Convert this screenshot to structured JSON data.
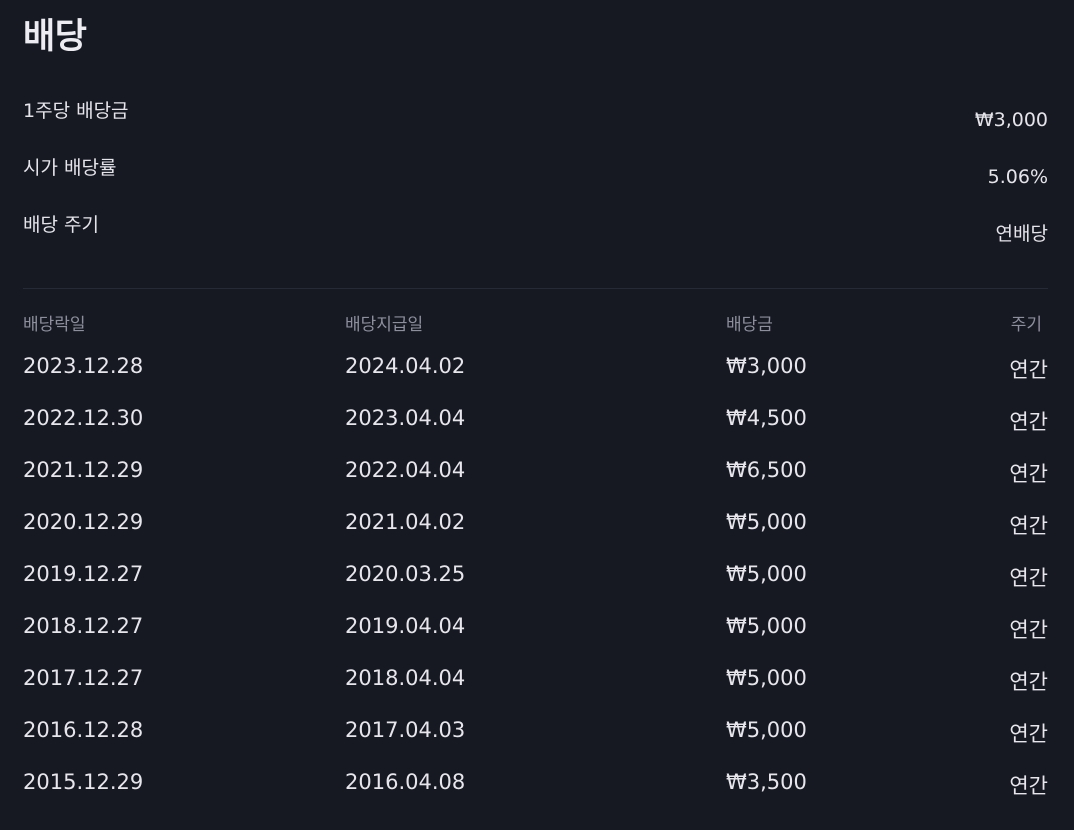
{
  "page": {
    "title": "배당"
  },
  "summary": [
    {
      "label": "1주당 배당금",
      "value": "₩3,000"
    },
    {
      "label": "시가 배당률",
      "value": "5.06%"
    },
    {
      "label": "배당 주기",
      "value": "연배당"
    }
  ],
  "table": {
    "headers": [
      "배당락일",
      "배당지급일",
      "배당금",
      "주기"
    ],
    "rows": [
      {
        "ex_date": "2023.12.28",
        "pay_date": "2024.04.02",
        "amount": "₩3,000",
        "cycle": "연간"
      },
      {
        "ex_date": "2022.12.30",
        "pay_date": "2023.04.04",
        "amount": "₩4,500",
        "cycle": "연간"
      },
      {
        "ex_date": "2021.12.29",
        "pay_date": "2022.04.04",
        "amount": "₩6,500",
        "cycle": "연간"
      },
      {
        "ex_date": "2020.12.29",
        "pay_date": "2021.04.02",
        "amount": "₩5,000",
        "cycle": "연간"
      },
      {
        "ex_date": "2019.12.27",
        "pay_date": "2020.03.25",
        "amount": "₩5,000",
        "cycle": "연간"
      },
      {
        "ex_date": "2018.12.27",
        "pay_date": "2019.04.04",
        "amount": "₩5,000",
        "cycle": "연간"
      },
      {
        "ex_date": "2017.12.27",
        "pay_date": "2018.04.04",
        "amount": "₩5,000",
        "cycle": "연간"
      },
      {
        "ex_date": "2016.12.28",
        "pay_date": "2017.04.03",
        "amount": "₩5,000",
        "cycle": "연간"
      },
      {
        "ex_date": "2015.12.29",
        "pay_date": "2016.04.08",
        "amount": "₩3,500",
        "cycle": "연간"
      }
    ]
  },
  "colors": {
    "background": "#161822",
    "text_primary": "#e6e6ec",
    "text_secondary": "#8d8f9c",
    "divider": "#262936"
  }
}
